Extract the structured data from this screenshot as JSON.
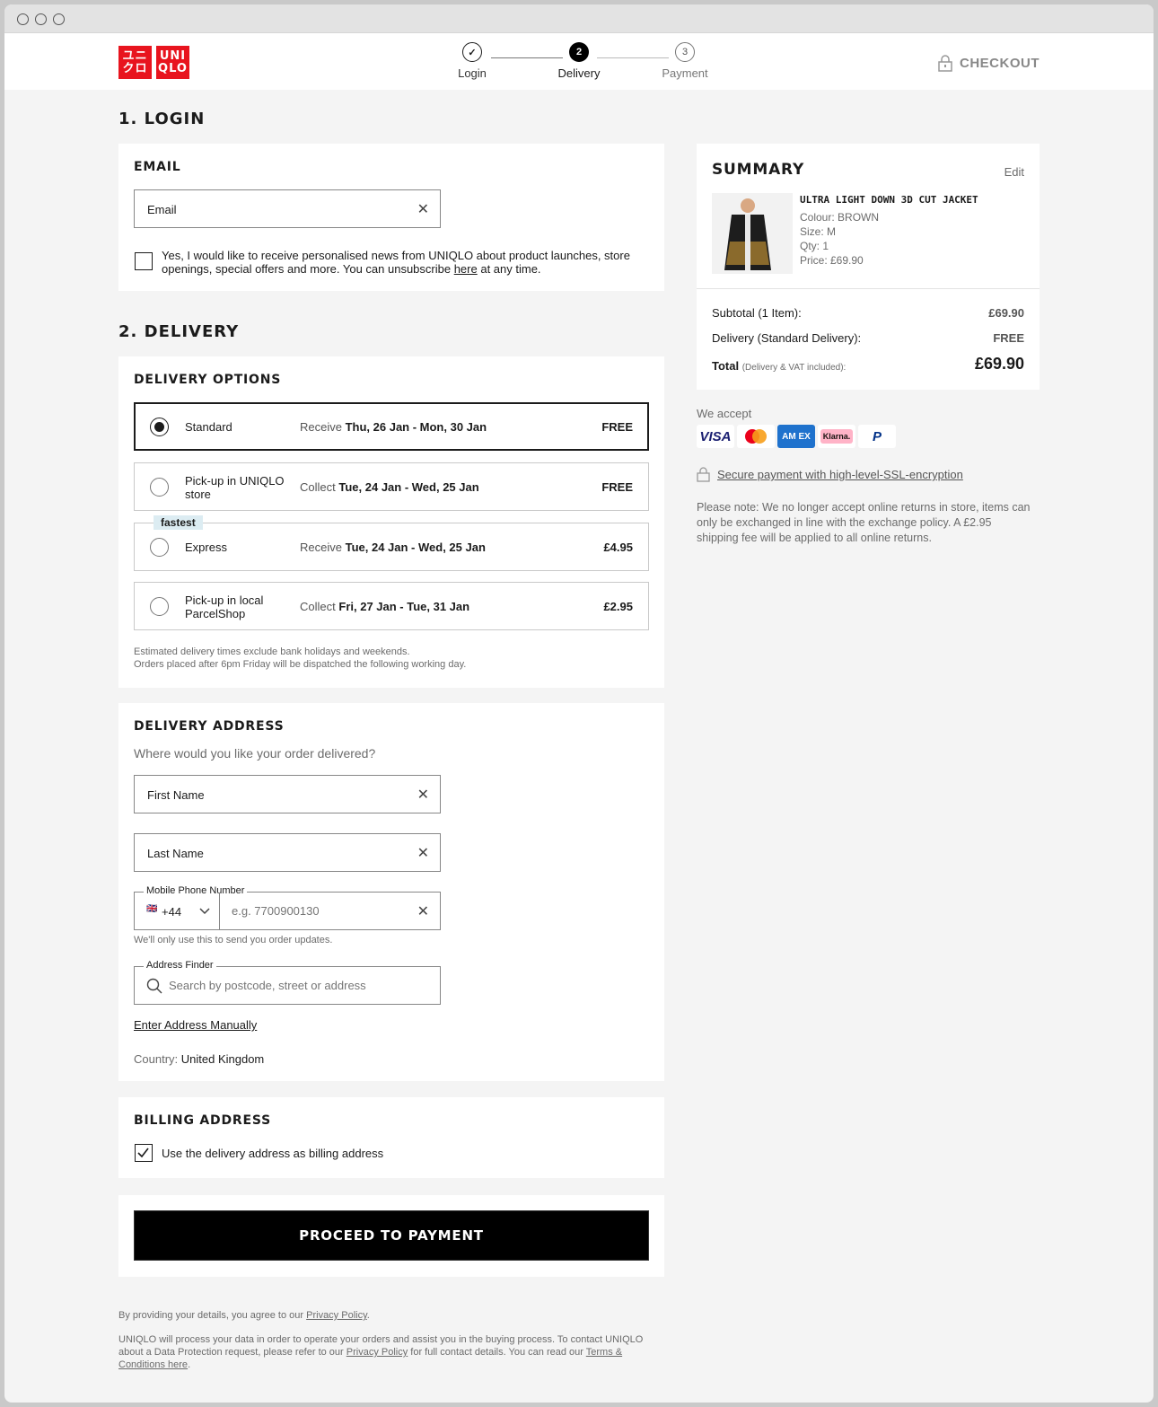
{
  "header": {
    "brand_top": "ユニ",
    "brand_bottom": "クロ",
    "brand_top_en": "UNI",
    "brand_bottom_en": "QLO",
    "steps": [
      {
        "label": "Login",
        "marker": "✓",
        "state": "done"
      },
      {
        "label": "Delivery",
        "marker": "2",
        "state": "active"
      },
      {
        "label": "Payment",
        "marker": "3",
        "state": "todo"
      }
    ],
    "checkout_label": "CHECKOUT",
    "brand_color": "#e8141e"
  },
  "login": {
    "section_title": "1. LOGIN",
    "card_title": "EMAIL",
    "email_value": "Email",
    "newsletter_text_a": "Yes, I would like to receive personalised news from UNIQLO about product launches, store openings, special offers and more. You can unsubscribe ",
    "newsletter_link": "here",
    "newsletter_text_b": " at any time.",
    "newsletter_checked": false
  },
  "delivery": {
    "section_title": "2. DELIVERY",
    "card_title": "DELIVERY OPTIONS",
    "options": [
      {
        "name": "Standard",
        "verb": "Receive",
        "dates": "Thu, 26 Jan - Mon, 30 Jan",
        "price": "FREE",
        "selected": true,
        "tag": ""
      },
      {
        "name": "Pick-up in UNIQLO store",
        "verb": "Collect",
        "dates": "Tue, 24 Jan - Wed, 25 Jan",
        "price": "FREE",
        "selected": false,
        "tag": ""
      },
      {
        "name": "Express",
        "verb": "Receive",
        "dates": "Tue, 24 Jan - Wed, 25 Jan",
        "price": "£4.95",
        "selected": false,
        "tag": "fastest"
      },
      {
        "name": "Pick-up in local ParcelShop",
        "verb": "Collect",
        "dates": "Fri, 27 Jan - Tue, 31 Jan",
        "price": "£2.95",
        "selected": false,
        "tag": ""
      }
    ],
    "note_1": "Estimated delivery times exclude bank holidays and weekends.",
    "note_2": "Orders placed after 6pm Friday will be dispatched the following working day."
  },
  "address": {
    "card_title": "DELIVERY ADDRESS",
    "subtitle": "Where would you like your order delivered?",
    "first_name": "First Name",
    "last_name": "Last Name",
    "phone_label": "Mobile Phone Number",
    "phone_flag": "🇬🇧",
    "phone_code": "+44",
    "phone_placeholder": "e.g. 7700900130",
    "phone_hint": "We'll only use this to send you order updates.",
    "finder_label": "Address Finder",
    "finder_placeholder": "Search by postcode, street or address",
    "manual_link": "Enter Address Manually",
    "country_label": "Country:",
    "country_value": "United Kingdom"
  },
  "billing": {
    "card_title": "BILLING ADDRESS",
    "same_label": "Use the delivery address as billing address",
    "same_checked": true
  },
  "proceed_label": "PROCEED TO PAYMENT",
  "legal": {
    "line1_a": "By providing your details, you agree to our ",
    "line1_link": "Privacy Policy",
    "line1_b": ".",
    "line2_a": "UNIQLO will process your data in order to operate your orders and assist you in the buying process. To contact UNIQLO about a Data Protection request, please refer to our ",
    "line2_link1": "Privacy Policy",
    "line2_b": " for full contact details. You can read our ",
    "line2_link2": "Terms & Conditions here",
    "line2_c": "."
  },
  "summary": {
    "title": "SUMMARY",
    "edit": "Edit",
    "product_name": "ULTRA LIGHT DOWN 3D CUT JACKET",
    "colour": "Colour: BROWN",
    "size": "Size: M",
    "qty": "Qty: 1",
    "price": "Price: £69.90",
    "subtotal_label": "Subtotal (1 Item):",
    "subtotal_value": "£69.90",
    "delivery_label": "Delivery (Standard Delivery):",
    "delivery_value": "FREE",
    "total_label": "Total",
    "total_note": "(Delivery & VAT included):",
    "total_value": "£69.90"
  },
  "payments": {
    "title": "We accept",
    "methods": [
      {
        "name": "VISA",
        "icon": "visa-icon",
        "bg": "#ffffff",
        "fg": "#1a1f71"
      },
      {
        "name": "",
        "icon": "mastercard-icon",
        "bg": "#ffffff",
        "fg": "#eb001b"
      },
      {
        "name": "AM EX",
        "icon": "amex-icon",
        "bg": "#1f72cd",
        "fg": "#ffffff"
      },
      {
        "name": "Klarna.",
        "icon": "klarna-icon",
        "bg": "#ffb3c7",
        "fg": "#17120f"
      },
      {
        "name": "P",
        "icon": "paypal-icon",
        "bg": "#ffffff",
        "fg": "#003087"
      }
    ],
    "secure_text": "Secure payment with high-level-SSL-encryption",
    "returns_note": "Please note: We no longer accept online returns in store, items can only be exchanged in line with the exchange policy. A £2.95 shipping fee will be applied to all online returns."
  }
}
